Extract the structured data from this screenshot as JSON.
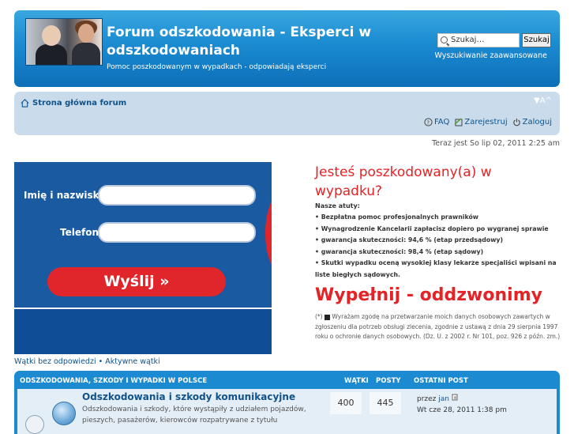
{
  "header": {
    "title": "Forum odszkodowania - Eksperci w odszkodowaniach",
    "description": "Pomoc poszkodowanym w wypadkach - odpowiadają eksperci",
    "search_placeholder": "Szukaj…",
    "search_button": "Szukaj",
    "advanced_search": "Wyszukiwanie zaawansowane"
  },
  "navbar": {
    "home": "Strona główna forum",
    "font_size": "▼A^",
    "faq": "FAQ",
    "register": "Zarejestruj",
    "login": "Zaloguj"
  },
  "time": "Teraz jest So lip 02, 2011 2:25 am",
  "ad": {
    "name_label": "Imię i nazwisko:",
    "phone_label": "Telefon:",
    "send_button": "Wyślij »"
  },
  "promo": {
    "title": "Jesteś poszkodowany(a) w wypadku?",
    "subtitle": "Nasze atuty:",
    "points": [
      "Bezpłatna pomoc profesjonalnych prawników",
      "Wynagrodzenie Kancelarii zapłacisz dopiero po wygranej sprawie",
      "gwarancja skuteczności: 94,6 % (etap przedsądowy)",
      "gwarancja skuteczności: 98,4 % (etap sądowy)",
      "Skutki wypadku oceną wysokiej klasy lekarze specjaliści wpisani na liste biegłych sądowych."
    ],
    "call": "Wypełnij - oddzwonimy",
    "consent_prefix": "(*)",
    "consent": "Wyrażam zgodę na przetwarzanie moich danych osobowych zawartych w zgłoszeniu dla potrzeb obsługi zlecenia, zgodnie z ustawą z dnia 29 sierpnia 1997 roku o ochronie danych osobowych. (Dz. U. z 2002 r. Nr 101, poz. 926 z późn. zm.)"
  },
  "quicklinks": {
    "unanswered": "Wątki bez odpowiedzi",
    "sep": " • ",
    "active": "Aktywne wątki"
  },
  "forum": {
    "category": "ODSZKODOWANIA, SZKODY I WYPADKI W POLSCE",
    "col_topics": "WĄTKI",
    "col_posts": "POSTY",
    "col_last": "OSTATNI POST",
    "row": {
      "title": "Odszkodowania i szkody komunikacyjne",
      "description": "Odszkodowania i szkody, które wystąpiły z udziałem pojazdów, pieszych, pasażerów, kierowców rozpatrywane z tytułu",
      "topics": "400",
      "posts": "445",
      "last_by": "przez",
      "last_user": "jan",
      "last_date": "Wt cze 28, 2011 1:38 pm"
    }
  }
}
